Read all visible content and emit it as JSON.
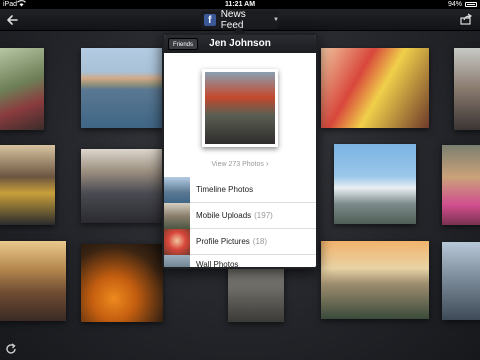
{
  "status_bar": {
    "carrier": "iPad",
    "time": "11:21 AM",
    "battery_pct": "94%"
  },
  "nav": {
    "title": "News Feed",
    "icons": [
      "back-arrow-icon",
      "facebook-icon",
      "chevron-down-icon",
      "share-icon"
    ]
  },
  "popover": {
    "friends_button": "Friends",
    "title": "Jen Johnson",
    "view_photos": "View 273 Photos",
    "albums": [
      {
        "label": "Timeline Photos",
        "count": ""
      },
      {
        "label": "Mobile Uploads",
        "count": "(197)"
      },
      {
        "label": "Profile Pictures",
        "count": "(18)"
      },
      {
        "label": "Wall Photos",
        "count": ""
      }
    ]
  },
  "icons": {
    "refresh": "refresh-icon"
  },
  "colors": {
    "facebook_blue": "#3b5998",
    "background": "#2a2c31",
    "nav_bar": "#16171a"
  }
}
